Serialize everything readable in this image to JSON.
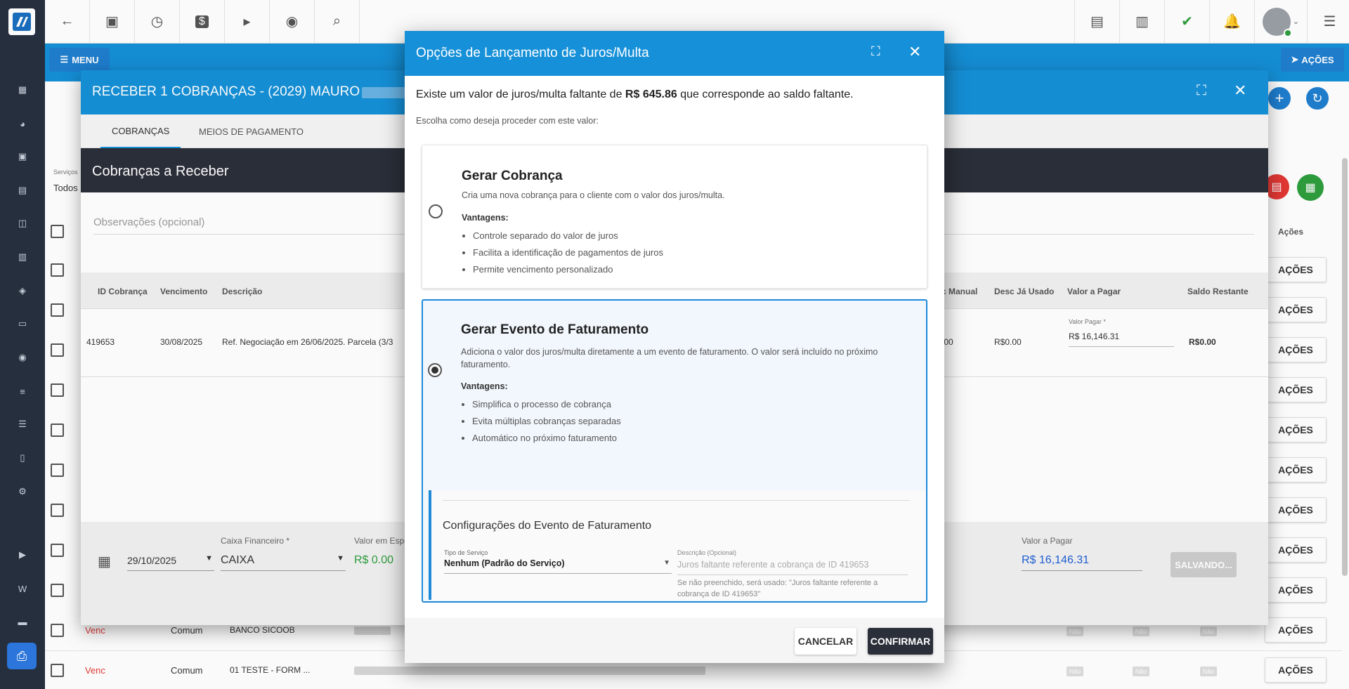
{
  "topbar": {
    "icons": [
      "back-arrow-icon",
      "contact-card-icon",
      "calendar-clock-icon",
      "dollar-icon",
      "terminal-icon",
      "eye-icon",
      "search-icon"
    ],
    "right_icons": [
      "pdf-icon",
      "building-icon",
      "chat-check-icon",
      "bell-icon"
    ],
    "menu_label": "MENU",
    "acoes_label": "AÇÕES"
  },
  "receber": {
    "title": "RECEBER 1 COBRANÇAS - (2029) MAURO",
    "tabs": [
      "COBRANÇAS",
      "MEIOS DE PAGAMENTO"
    ],
    "section_title": "Cobranças a Receber",
    "obs_placeholder": "Observações (opcional)",
    "columns": [
      "ID Cobrança",
      "Vencimento",
      "Descrição",
      "c Manual",
      "Desc Já Usado",
      "Valor a Pagar",
      "Saldo Restante"
    ],
    "row": {
      "id": "419653",
      "vencimento": "30/08/2025",
      "descricao": "Ref. Negociação em 26/06/2025. Parcela (3/3",
      "desc_manual": ".00",
      "desc_ja_usado": "R$0.00",
      "valor_pagar_label": "Valor Pagar *",
      "valor_pagar": "R$ 16,146.31",
      "saldo_restante": "R$0.00"
    },
    "footer": {
      "date": "29/10/2025",
      "caixa_label": "Caixa Financeiro *",
      "caixa_value": "CAIXA",
      "valor_especie_label": "Valor em Espe",
      "valor_especie": "R$ 0.00",
      "valor_pagar_label": "Valor a Pagar",
      "valor_pagar": "R$ 16,146.31",
      "salvando": "SALVANDO..."
    }
  },
  "background": {
    "servicos_label": "Serviços",
    "servicos_value": "Todos",
    "acoes_header": "Ações",
    "acoes_label": "AÇÕES",
    "rows": [
      {
        "status": "Venc",
        "tipo": "Comum",
        "conta": "BANCO SICOOB",
        "nao": "Não"
      },
      {
        "status": "Venc",
        "tipo": "Comum",
        "conta": "01 TESTE - FORM ...",
        "nao": "Não"
      }
    ]
  },
  "dialog": {
    "title": "Opções de Lançamento de Juros/Multa",
    "intro_prefix": "Existe um valor de juros/multa faltante de ",
    "intro_amount": "R$ 645.86",
    "intro_suffix": " que corresponde ao saldo faltante.",
    "choose": "Escolha como deseja proceder com este valor:",
    "option1": {
      "title": "Gerar Cobrança",
      "desc": "Cria uma nova cobrança para o cliente com o valor dos juros/multa.",
      "vantagens": "Vantagens:",
      "items": [
        "Controle separado do valor de juros",
        "Facilita a identificação de pagamentos de juros",
        "Permite vencimento personalizado"
      ]
    },
    "option2": {
      "title": "Gerar Evento de Faturamento",
      "desc": "Adiciona o valor dos juros/multa diretamente a um evento de faturamento. O valor será incluído no próximo faturamento.",
      "vantagens": "Vantagens:",
      "items": [
        "Simplifica o processo de cobrança",
        "Evita múltiplas cobranças separadas",
        "Automático no próximo faturamento"
      ]
    },
    "config": {
      "title": "Configurações do Evento de Faturamento",
      "tipo_label": "Tipo de Serviço",
      "tipo_value": "Nenhum (Padrão do Serviço)",
      "desc_label": "Descrição (Opcional)",
      "desc_placeholder": "Juros faltante referente a cobrança de ID 419653",
      "hint": "Se não preenchido, será usado: \"Juros faltante referente a cobrança de ID 419653\""
    },
    "cancel": "CANCELAR",
    "confirm": "CONFIRMAR"
  }
}
